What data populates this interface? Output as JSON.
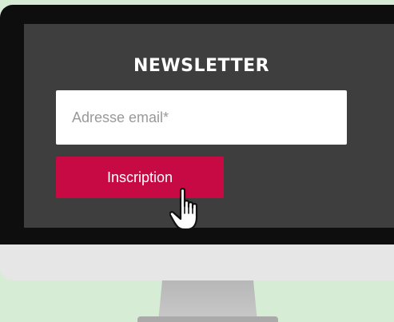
{
  "newsletter": {
    "title": "NEWSLETTER",
    "email_placeholder": "Adresse email*",
    "email_value": "",
    "submit_label": "Inscription"
  },
  "cursor": {
    "icon": "hand-pointer-icon"
  },
  "colors": {
    "background": "#d6ecd4",
    "screen": "#3e3e3e",
    "bezel": "#0e0e0e",
    "monitor_chin": "#e6e6e6",
    "button": "#c70a44",
    "button_text": "#ffffff"
  }
}
